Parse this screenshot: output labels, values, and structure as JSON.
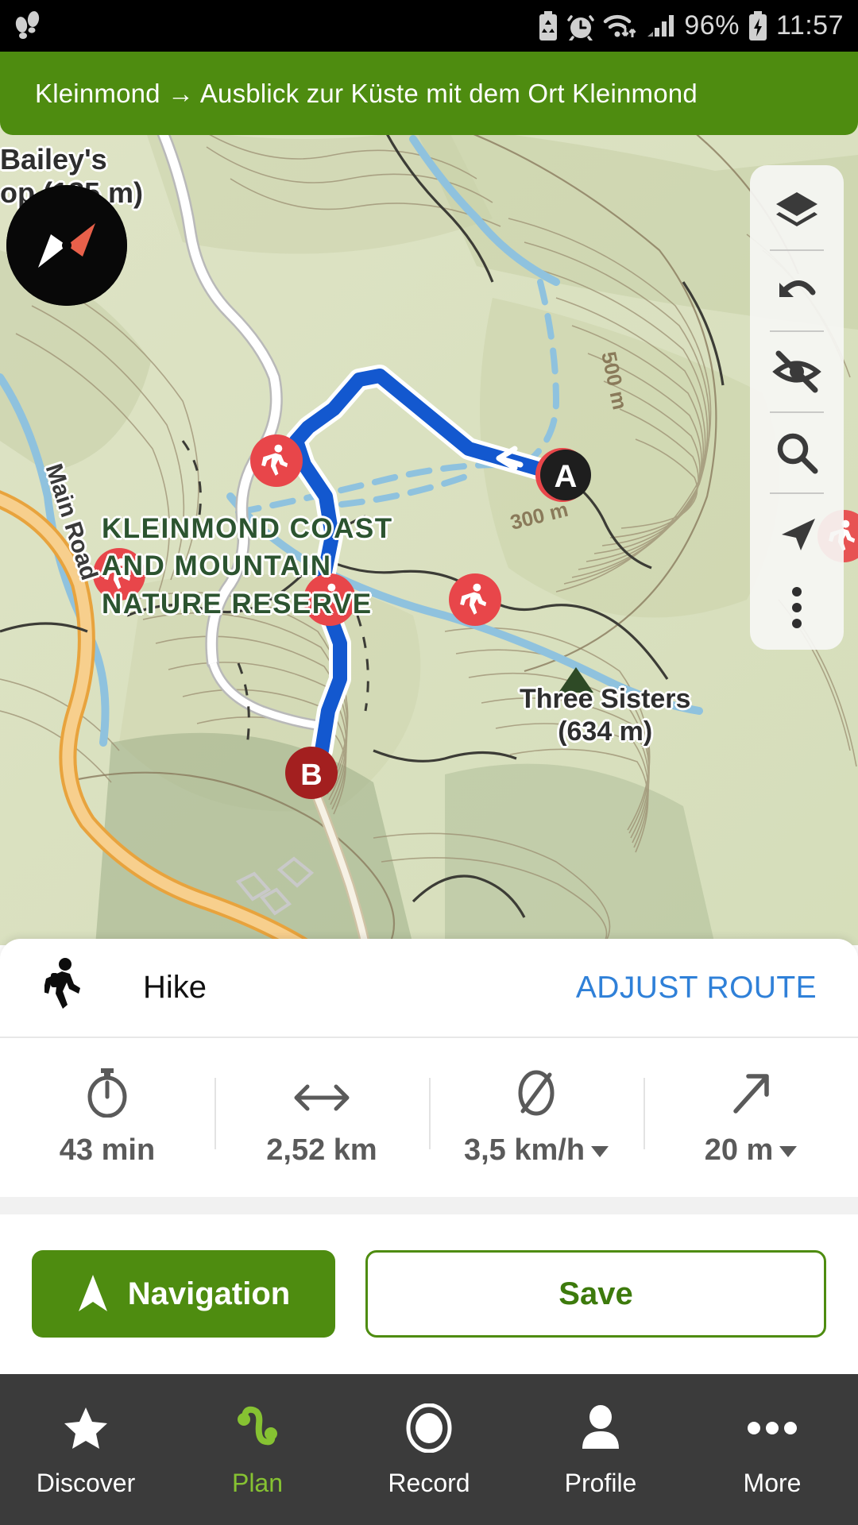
{
  "status_bar": {
    "left_icons": [
      "footprints-icon"
    ],
    "right_icons": [
      "battery-saver-icon",
      "alarm-icon",
      "wifi-icon",
      "signal-icon",
      "charging-battery-icon"
    ],
    "battery_percent": "96%",
    "time": "11:57"
  },
  "header": {
    "title": "Kleinmond → Ausblick zur Küste mit dem Ort Kleinmond",
    "background_color": "#4e8c10"
  },
  "map": {
    "compass_label": "compass",
    "route_color": "#1358cf",
    "marker_start": "A",
    "marker_end": "B",
    "labels": [
      {
        "text": "Bailey's",
        "text2": "op (185 m)"
      },
      {
        "text": "Main Road"
      },
      {
        "text": "KLEINMOND COAST"
      },
      {
        "text": "AND MOUNTAIN"
      },
      {
        "text": "NATURE RESERVE"
      },
      {
        "text": "Three Sisters"
      },
      {
        "text": "(634 m)"
      },
      {
        "text": "500 m"
      },
      {
        "text": "300 m"
      }
    ],
    "contour_labels": [
      "500 m",
      "300 m"
    ],
    "peak_labels": [
      {
        "name": "Three Sisters",
        "elevation": "(634 m)"
      },
      {
        "name": "Bailey's",
        "elevation": "op (185 m)"
      }
    ],
    "reserve_name_lines": [
      "KLEINMOND COAST",
      "AND MOUNTAIN",
      "NATURE RESERVE"
    ],
    "road_label": "Main Road",
    "controls": [
      {
        "name": "layers-icon",
        "label": "Layers"
      },
      {
        "name": "undo-icon",
        "label": "Undo"
      },
      {
        "name": "eye-off-icon",
        "label": "Hide"
      },
      {
        "name": "search-icon",
        "label": "Search"
      },
      {
        "name": "locate-icon",
        "label": "Locate"
      },
      {
        "name": "more-vertical-icon",
        "label": "More"
      }
    ]
  },
  "sheet": {
    "activity_icon": "hiker-icon",
    "activity_label": "Hike",
    "adjust_route_label": "ADJUST ROUTE",
    "stats": [
      {
        "icon": "stopwatch-icon",
        "value": "43 min",
        "has_caret": false
      },
      {
        "icon": "distance-arrow-icon",
        "value": "2,52 km",
        "has_caret": false
      },
      {
        "icon": "average-speed-icon",
        "value": "3,5 km/h",
        "has_caret": true
      },
      {
        "icon": "ascent-arrow-icon",
        "value": "20 m",
        "has_caret": true
      }
    ],
    "navigation_button": {
      "label": "Navigation",
      "icon": "navigation-arrow-icon",
      "color": "#4e8c10"
    },
    "save_button": {
      "label": "Save",
      "color": "#4e8c10"
    }
  },
  "bottom_nav": {
    "active_index": 1,
    "active_color": "#86c232",
    "items": [
      {
        "label": "Discover",
        "icon": "star-icon"
      },
      {
        "label": "Plan",
        "icon": "route-icon"
      },
      {
        "label": "Record",
        "icon": "record-circle-icon"
      },
      {
        "label": "Profile",
        "icon": "person-icon"
      },
      {
        "label": "More",
        "icon": "more-horizontal-icon"
      }
    ]
  }
}
